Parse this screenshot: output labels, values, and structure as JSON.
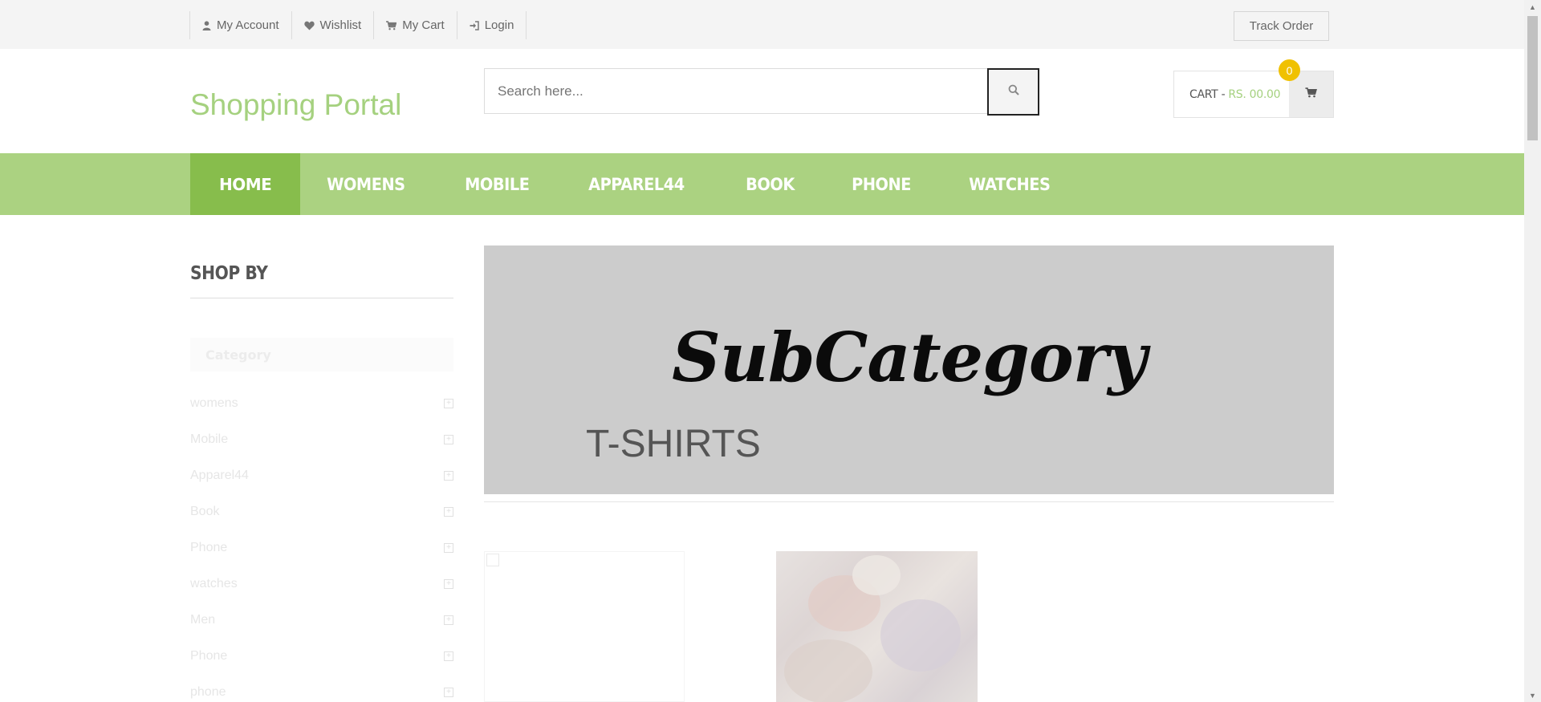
{
  "topbar": {
    "links": [
      {
        "label": "My Account",
        "icon": "user-icon"
      },
      {
        "label": "Wishlist",
        "icon": "heart-icon"
      },
      {
        "label": "My Cart",
        "icon": "cart-icon"
      },
      {
        "label": "Login",
        "icon": "login-icon"
      }
    ],
    "track_order": "Track Order"
  },
  "header": {
    "logo": "Shopping Portal",
    "search_placeholder": "Search here...",
    "cart_label": "CART -",
    "cart_amount": "RS. 00.00",
    "cart_count": "0"
  },
  "nav": {
    "items": [
      "HOME",
      "WOMENS",
      "MOBILE",
      "APPAREL44",
      "BOOK",
      "PHONE",
      "WATCHES"
    ],
    "active": "HOME"
  },
  "sidebar": {
    "title": "SHOP BY",
    "category_header": "Category",
    "categories": [
      "womens",
      "Mobile",
      "Apparel44",
      "Book",
      "Phone",
      "watches",
      "Men",
      "Phone",
      "phone"
    ]
  },
  "banner": {
    "title": "SubCategory",
    "subtitle": "T-SHIRTS"
  },
  "colors": {
    "accent": "#abd281",
    "accent_dark": "#87bd4c",
    "logo": "#a5d17f",
    "badge": "#f0c100"
  }
}
